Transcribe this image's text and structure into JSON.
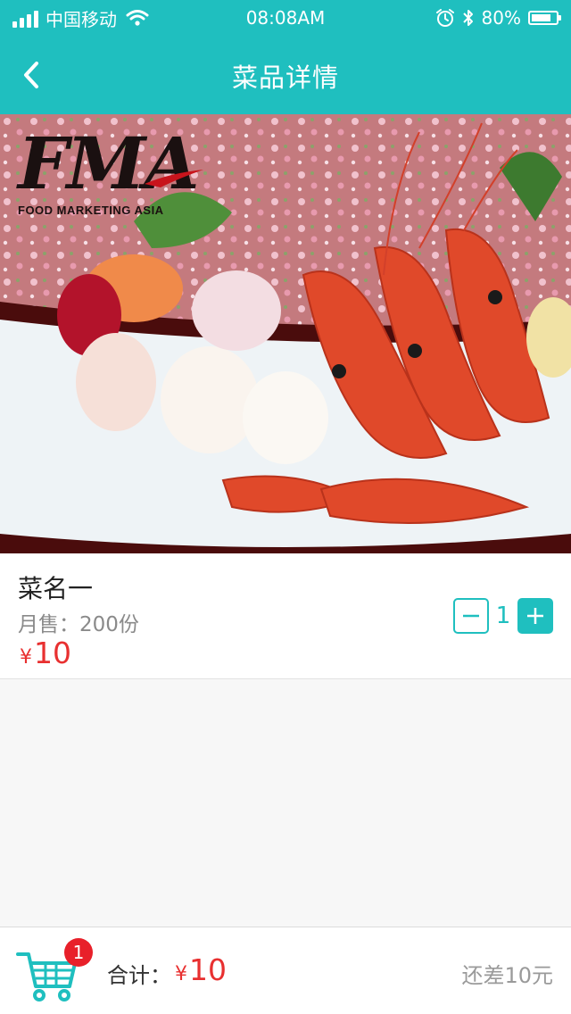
{
  "status_bar": {
    "carrier": "中国移动",
    "time": "08:08AM",
    "battery": "80%",
    "battery_level": 0.8
  },
  "nav": {
    "title": "菜品详情",
    "back_icon": "chevron-left-icon"
  },
  "hero": {
    "logo_text": "FMA",
    "logo_subtitle": "FOOD MARKETING ASIA"
  },
  "dish": {
    "name": "菜名一",
    "sales": "月售：200份",
    "price_symbol": "¥",
    "price": "10",
    "quantity": "1"
  },
  "footer": {
    "cart_icon": "shopping-cart-icon",
    "cart_badge": "1",
    "total_label": "合计：",
    "total_symbol": "¥",
    "total": "10",
    "remaining": "还差10元"
  },
  "colors": {
    "accent": "#1fbfbf",
    "price": "#e83030",
    "badge": "#e8202a"
  }
}
